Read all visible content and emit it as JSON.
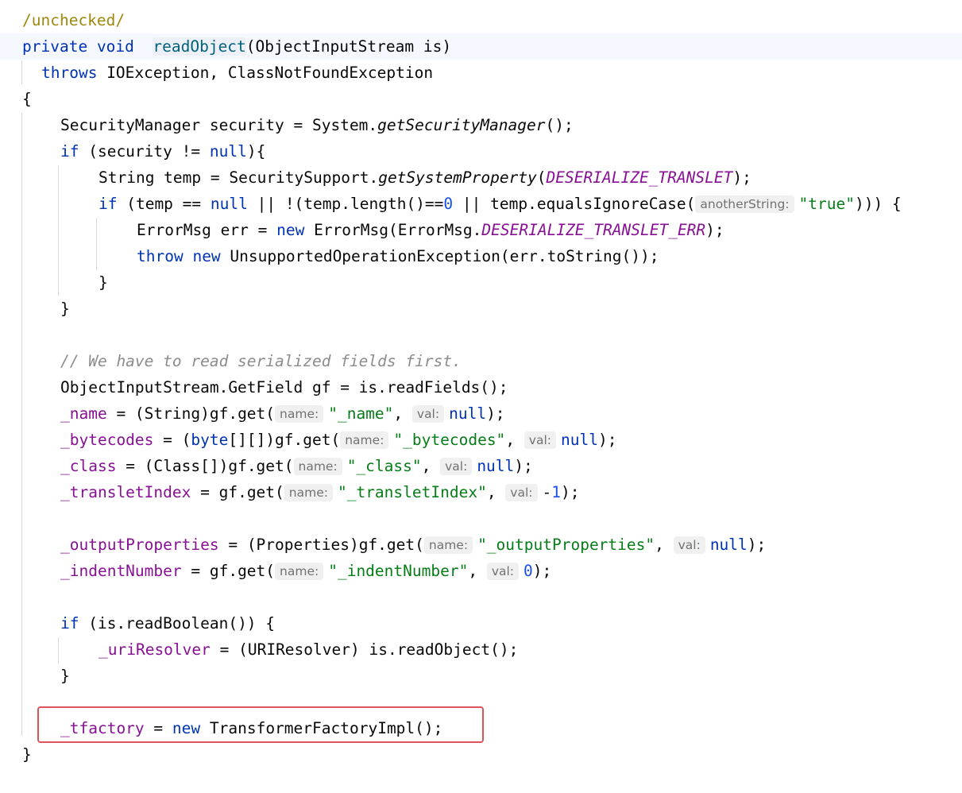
{
  "lines": {
    "l1": {
      "ann": "/unchecked/"
    },
    "l2": {
      "kw1": "private",
      "kw2": "void",
      "method": "readObject",
      "params": "(ObjectInputStream is)"
    },
    "l3": {
      "kw": "throws",
      "rest": " IOException, ClassNotFoundException"
    },
    "l4": {
      "text": "{"
    },
    "l5": {
      "a": "SecurityManager security = System.",
      "call": "getSecurityManager",
      "b": "();"
    },
    "l6": {
      "kw": "if",
      "a": " (security != ",
      "nul": "null",
      "b": "){"
    },
    "l7": {
      "a": "String temp = SecuritySupport.",
      "call": "getSystemProperty",
      "b": "(",
      "const": "DESERIALIZE_TRANSLET",
      "c": ");"
    },
    "l8": {
      "kw": "if",
      "a": " (temp == ",
      "nul": "null",
      "b": " || !(temp.length()==",
      "zero": "0",
      "c": " || temp.equalsIgnoreCase(",
      "hint": "anotherString:",
      "str": "\"true\"",
      "d": "))) {"
    },
    "l9": {
      "a": "ErrorMsg err = ",
      "kw": "new",
      "b": " ErrorMsg(ErrorMsg.",
      "const": "DESERIALIZE_TRANSLET_ERR",
      "c": ");"
    },
    "l10": {
      "kw1": "throw",
      "kw2": "new",
      "rest": " UnsupportedOperationException(err.toString());"
    },
    "l11": {
      "text": "}"
    },
    "l12": {
      "text": "}"
    },
    "l14": {
      "comment": "// We have to read serialized fields first."
    },
    "l15": {
      "text": "ObjectInputStream.GetField gf = is.readFields();"
    },
    "l16": {
      "field": "_name",
      "a": " = (String)gf.get(",
      "hint1": "name:",
      "str": "\"_name\"",
      "b": ", ",
      "hint2": "val:",
      "nul": "null",
      "c": ");"
    },
    "l17": {
      "field": "_bytecodes",
      "a": " = (",
      "kw": "byte",
      "a2": "[][])gf.get(",
      "hint1": "name:",
      "str": "\"_bytecodes\"",
      "b": ", ",
      "hint2": "val:",
      "nul": "null",
      "c": ");"
    },
    "l18": {
      "field": "_class",
      "a": " = (Class[])gf.get(",
      "hint1": "name:",
      "str": "\"_class\"",
      "b": ", ",
      "hint2": "val:",
      "nul": "null",
      "c": ");"
    },
    "l19": {
      "field": "_transletIndex",
      "a": " = gf.get(",
      "hint1": "name:",
      "str": "\"_transletIndex\"",
      "b": ", ",
      "hint2": "val:",
      "minus": "-",
      "num": "1",
      "c": ");"
    },
    "l21": {
      "field": "_outputProperties",
      "a": " = (Properties)gf.get(",
      "hint1": "name:",
      "str": "\"_outputProperties\"",
      "b": ", ",
      "hint2": "val:",
      "nul": "null",
      "c": ");"
    },
    "l22": {
      "field": "_indentNumber",
      "a": " = gf.get(",
      "hint1": "name:",
      "str": "\"_indentNumber\"",
      "b": ", ",
      "hint2": "val:",
      "num": "0",
      "c": ");"
    },
    "l24": {
      "kw": "if",
      "a": " (is.readBoolean()) {"
    },
    "l25": {
      "field": "_uriResolver",
      "a": " = (URIResolver) is.readObject();"
    },
    "l26": {
      "text": "}"
    },
    "l28": {
      "field": "_tfactory",
      "a": " = ",
      "kw": "new",
      "b": " TransformerFactoryImpl();"
    },
    "l29": {
      "text": "}"
    }
  },
  "colors": {
    "keyword": "#0033b3",
    "method": "#00627a",
    "field": "#871094",
    "string": "#067d17",
    "number": "#1750eb",
    "comment": "#8c8c8c",
    "highlight_box": "#e0525e"
  }
}
